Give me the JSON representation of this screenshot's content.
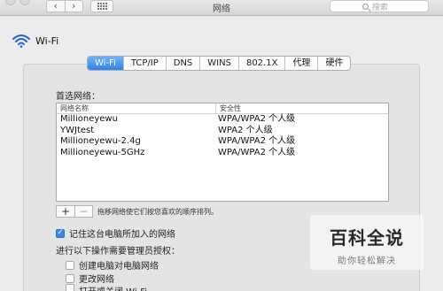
{
  "window": {
    "title": "网络",
    "search_placeholder": "搜索",
    "back_glyph": "‹",
    "forward_glyph": "›"
  },
  "header": {
    "label": "Wi-Fi"
  },
  "tabs": [
    {
      "label": "Wi-Fi",
      "active": true
    },
    {
      "label": "TCP/IP",
      "active": false
    },
    {
      "label": "DNS",
      "active": false
    },
    {
      "label": "WINS",
      "active": false
    },
    {
      "label": "802.1X",
      "active": false
    },
    {
      "label": "代理",
      "active": false
    },
    {
      "label": "硬件",
      "active": false
    }
  ],
  "preferred": {
    "label": "首选网络：",
    "columns": [
      "网络名称",
      "安全性"
    ],
    "rows": [
      {
        "name": "Millioneyewu",
        "security": "WPA/WPA2 个人级"
      },
      {
        "name": "YWJtest",
        "security": "WPA2 个人级"
      },
      {
        "name": "Millioneyewu-2.4g",
        "security": "WPA/WPA2 个人级"
      },
      {
        "name": "Millioneyewu-5GHz",
        "security": "WPA/WPA2 个人级"
      }
    ],
    "add_label": "+",
    "remove_label": "−",
    "drag_hint": "拖移网络使它们按您喜欢的顺序排列。"
  },
  "options": {
    "remember_label": "记住这台电脑所加入的网络",
    "remember_checked": true,
    "admin_label": "进行以下操作需要管理员授权：",
    "admin_items": [
      {
        "label": "创建电脑对电脑网络",
        "checked": false
      },
      {
        "label": "更改网络",
        "checked": false
      },
      {
        "label": "打开或关闭 Wi-Fi",
        "checked": false
      }
    ]
  },
  "watermark": {
    "title": "百科全说",
    "subtitle": "助你轻松解决"
  },
  "colors": {
    "accent": "#3b86ea",
    "tab_active": "#2f83ea",
    "wifi_icon": "#1f5fd6"
  }
}
